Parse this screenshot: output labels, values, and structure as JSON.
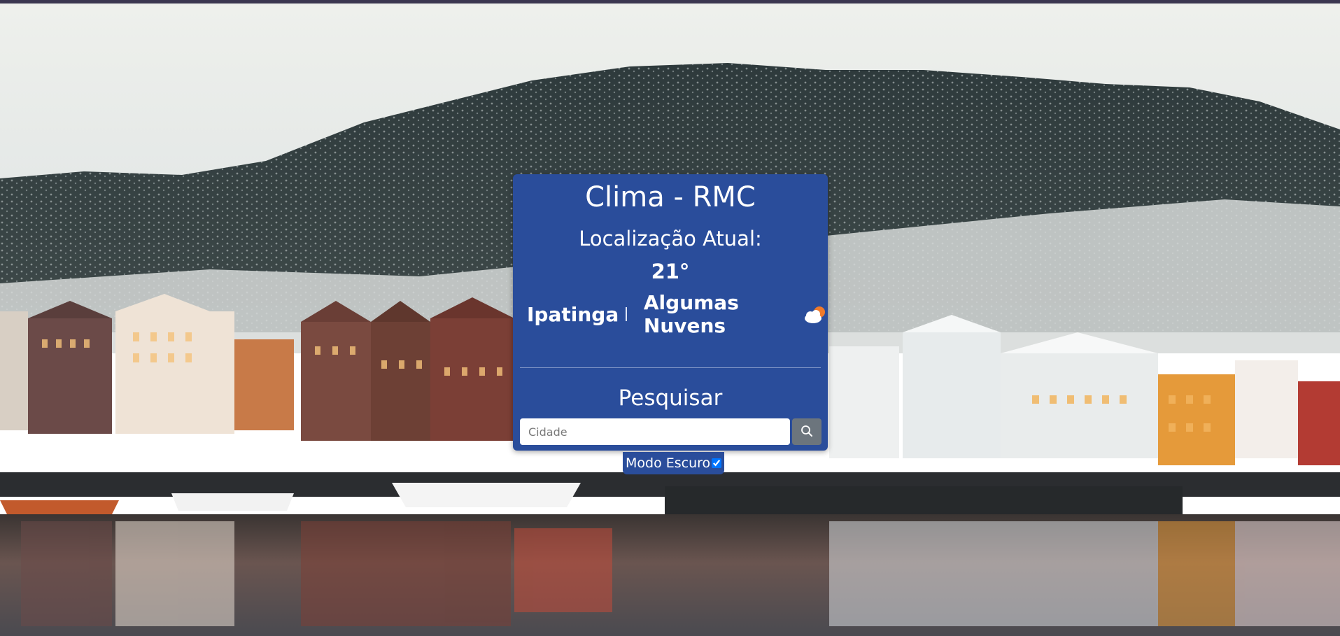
{
  "app": {
    "title": "Clima - RMC"
  },
  "current": {
    "location_label": "Localização Atual:",
    "temperature": "21°",
    "city": "Ipatinga",
    "condition": "Algumas Nuvens",
    "condition_icon": "partly-cloudy-icon"
  },
  "search": {
    "title": "Pesquisar",
    "placeholder": "Cidade",
    "value": "",
    "button_icon": "search-icon"
  },
  "dark_mode": {
    "label": "Modo Escuro",
    "checked": true
  },
  "colors": {
    "card": "#2a4d9b",
    "search_button": "#6c757d",
    "topbar": "#3b3650"
  }
}
